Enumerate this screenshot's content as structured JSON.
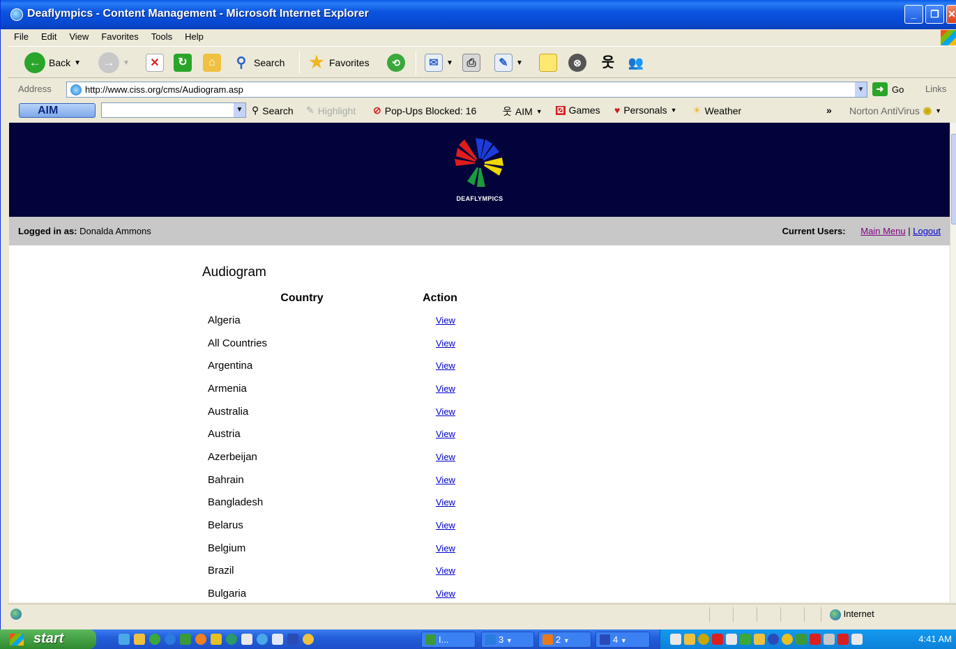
{
  "window": {
    "title": "Deaflympics - Content Management - Microsoft Internet Explorer",
    "menu": [
      "File",
      "Edit",
      "View",
      "Favorites",
      "Tools",
      "Help"
    ]
  },
  "toolbar": {
    "back_label": "Back",
    "search_label": "Search",
    "favorites_label": "Favorites"
  },
  "address_bar": {
    "label": "Address",
    "url": "http://www.ciss.org/cms/Audiogram.asp",
    "go_label": "Go",
    "links_label": "Links"
  },
  "aim_bar": {
    "logo": "AIM",
    "search_label": "Search",
    "highlight_label": "Highlight",
    "popups_label": "Pop-Ups Blocked: 16",
    "aim_label": "AIM",
    "games_label": "Games",
    "personals_label": "Personals",
    "weather_label": "Weather",
    "norton_label": "Norton AntiVirus"
  },
  "page": {
    "logo_text": "DEAFLYMPICS",
    "logged_in_label": "Logged in as:",
    "logged_in_user": "Donalda Ammons",
    "current_users_label": "Current Users:",
    "main_menu_link": "Main Menu",
    "separator": "|",
    "logout_link": "Logout",
    "title": "Audiogram",
    "table": {
      "headers": [
        "Country",
        "Action"
      ],
      "rows": [
        {
          "country": "Algeria",
          "action": "View"
        },
        {
          "country": "All Countries",
          "action": "View"
        },
        {
          "country": "Argentina",
          "action": "View"
        },
        {
          "country": "Armenia",
          "action": "View"
        },
        {
          "country": "Australia",
          "action": "View"
        },
        {
          "country": "Austria",
          "action": "View"
        },
        {
          "country": "Azerbeijan",
          "action": "View"
        },
        {
          "country": "Bahrain",
          "action": "View"
        },
        {
          "country": "Bangladesh",
          "action": "View"
        },
        {
          "country": "Belarus",
          "action": "View"
        },
        {
          "country": "Belgium",
          "action": "View"
        },
        {
          "country": "Brazil",
          "action": "View"
        },
        {
          "country": "Bulgaria",
          "action": "View"
        }
      ]
    }
  },
  "status_bar": {
    "zone": "Internet"
  },
  "taskbar": {
    "start_label": "start",
    "tasks": [
      {
        "label": "I...",
        "color": "#3a9a3a"
      },
      {
        "label": "3",
        "color": "#2a7ae0"
      },
      {
        "label": "2",
        "color": "#e87a1c"
      },
      {
        "label": "4",
        "color": "#2a4ab8"
      }
    ],
    "clock": "4:41 AM"
  },
  "colors": {
    "banner_bg": "#02033a",
    "userbar_bg": "#c8c8c8",
    "link": "#0000cc",
    "visited_link": "#800080"
  }
}
